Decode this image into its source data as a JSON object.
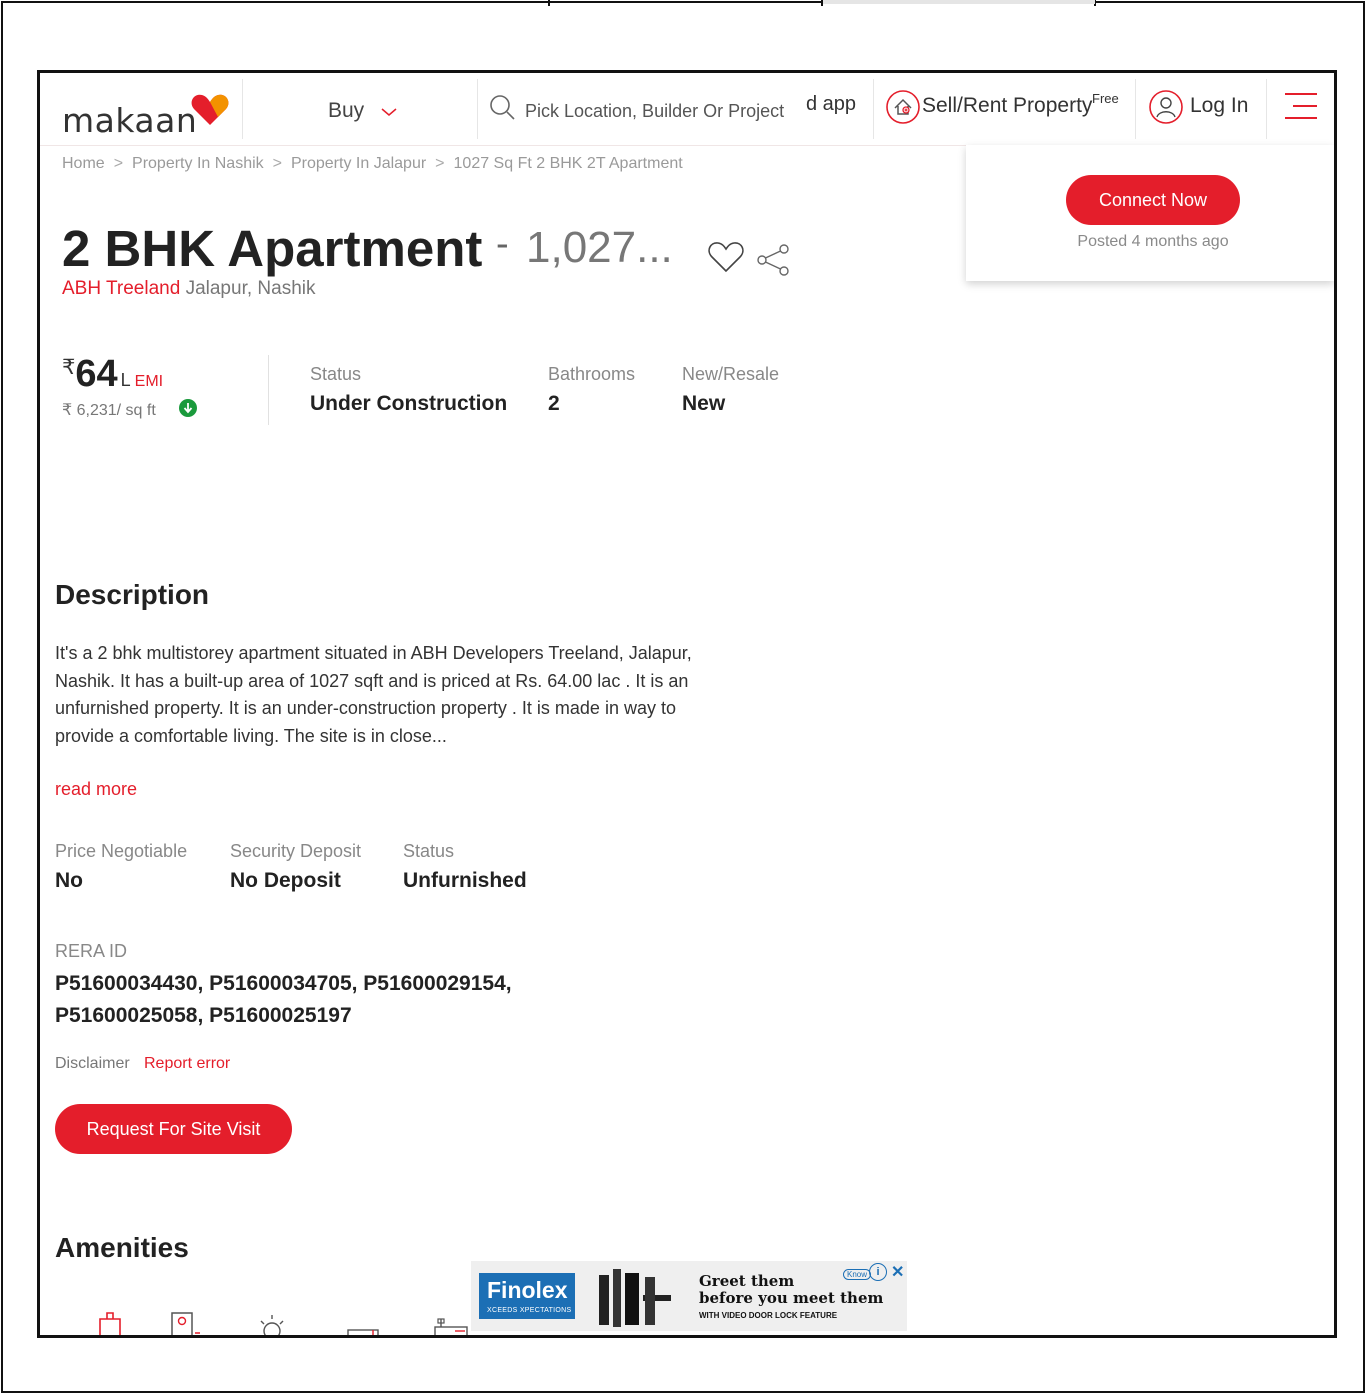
{
  "header": {
    "logo": "makaan",
    "buy_label": "Buy",
    "search_placeholder": "Pick Location, Builder Or Project",
    "app_fragment": "d app",
    "sell_label": "Sell/Rent Property",
    "free_tag": "Free",
    "login_label": "Log In"
  },
  "connect_panel": {
    "button_label": "Connect Now",
    "posted": "Posted 4 months ago"
  },
  "breadcrumb": [
    "Home",
    "Property In Nashik",
    "Property In Jalapur",
    "1027 Sq Ft 2 BHK 2T Apartment"
  ],
  "breadcrumb_separator": ">",
  "title": {
    "main": "2 BHK Apartment",
    "dash": "-",
    "area": "1,027...",
    "project": "ABH Treeland",
    "locality": "Jalapur,",
    "city": "Nashik"
  },
  "price": {
    "currency": "₹",
    "value": "64",
    "unit": "L",
    "emi": "EMI",
    "rate": "₹ 6,231/ sq ft"
  },
  "specs": [
    {
      "label": "Status",
      "value": "Under Construction"
    },
    {
      "label": "Bathrooms",
      "value": "2"
    },
    {
      "label": "New/Resale",
      "value": "New"
    }
  ],
  "description": {
    "title": "Description",
    "text": "It's a 2 bhk multistorey apartment situated in ABH Developers Treeland, Jalapur, Nashik. It has a built-up area of 1027 sqft and is priced at Rs. 64.00 lac . It is an unfurnished property. It is an under-construction property . It is made in way to provide a comfortable living. The site is in close...",
    "read_more": "read more"
  },
  "details": [
    {
      "label": "Price Negotiable",
      "value": "No"
    },
    {
      "label": "Security Deposit",
      "value": "No Deposit"
    },
    {
      "label": "Status",
      "value": "Unfurnished"
    }
  ],
  "rera": {
    "label": "RERA ID",
    "value": "P51600034430, P51600034705, P51600029154, P51600025058, P51600025197"
  },
  "disclaimer": "Disclaimer",
  "report_error": "Report error",
  "site_visit_button": "Request For Site Visit",
  "amenities": {
    "title": "Amenities",
    "icons": [
      "lift-icon",
      "security-icon",
      "power-backup-icon",
      "parking-icon",
      "gym-icon"
    ]
  },
  "ad": {
    "brand": "Finolex",
    "tagline": "XCEEDS XPECTATIONS",
    "headline_line1": "Greet them",
    "headline_line2": "before you meet them",
    "subline": "WITH VIDEO DOOR LOCK FEATURE",
    "know_more": "Know",
    "info": "i",
    "close": "✕"
  },
  "colors": {
    "accent": "#e41e2b",
    "text": "#222222",
    "muted": "#888888",
    "ad_blue": "#1c6fb5"
  }
}
